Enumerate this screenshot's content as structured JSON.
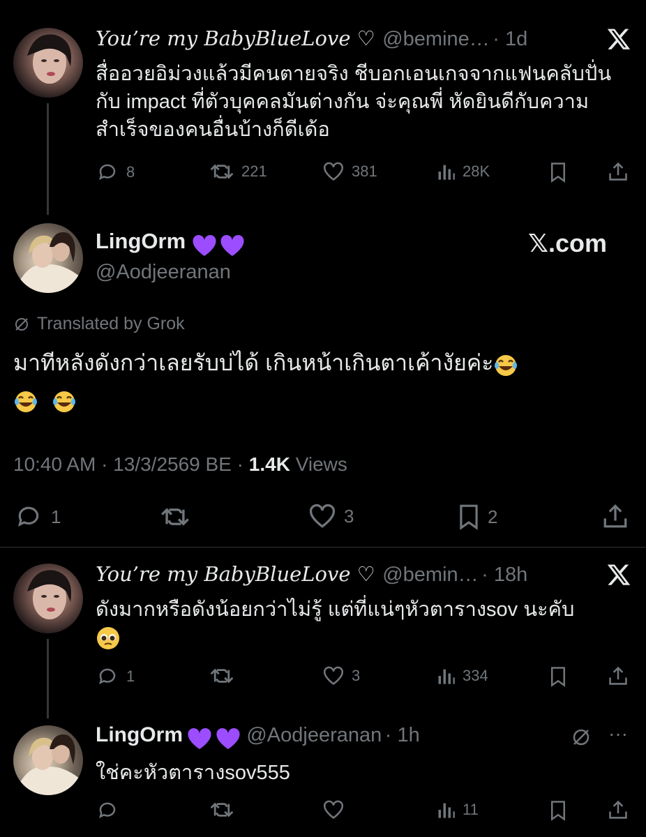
{
  "tweet1": {
    "display_name": "You’re my BabyBlueLove ♡",
    "handle": "@bemine…",
    "time": "· 1d",
    "text": "สื่ออวยอิม่วงแล้วมีคนตายจริง ชีบอกเอนเกจจากแฟนคลับปั่นกับ impact ที่ตัวบุคคลมันต่างกัน จ่ะคุณพี่ หัดยินดีกับความสำเร็จของคนอื่นบ้างก็ดีเด้อ",
    "replies": "8",
    "reposts": "221",
    "likes": "381",
    "views": "28K"
  },
  "main_tweet": {
    "display_name": "LingOrm",
    "handle": "@Aodjeeranan",
    "brand_label": "𝕏.com",
    "translated_label": "Translated by Grok",
    "text": "มาทีหลังดังกว่าเลยรับบ่ได้ เกินหน้าเกินตาเค้างัยค่ะ",
    "timestamp": "10:40 AM · 13/3/2569 BE ·",
    "view_count": "1.4K",
    "views_label": "Views",
    "replies": "1",
    "likes": "3",
    "bookmarks": "2"
  },
  "tweet3": {
    "display_name": "You’re my BabyBlueLove ♡",
    "handle": "@bemin…",
    "time": "· 18h",
    "text": "ดังมากหรือดังน้อยกว่าไม่รู้ แต่ที่แน่ๆหัวตารางsov นะคับ",
    "replies": "1",
    "likes": "3",
    "views": "334"
  },
  "tweet4": {
    "display_name": "LingOrm",
    "handle": "@Aodjeeranan",
    "time": "· 1h",
    "more": "···",
    "text": "ใช่คะหัวตารางsov555",
    "views": "11"
  },
  "colors": {
    "background": "#000000",
    "text": "#e7e9ea",
    "muted": "#71767b",
    "heart_purple": "#9b4dff",
    "divider": "#2f3336"
  }
}
